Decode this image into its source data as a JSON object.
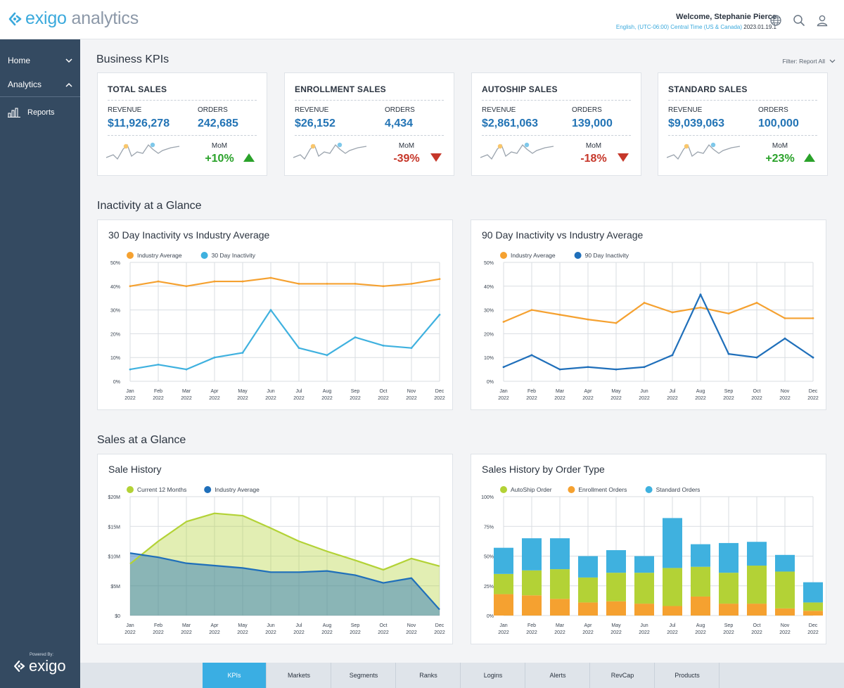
{
  "header": {
    "logo_word": "exigo",
    "logo_word_2": "analytics",
    "welcome": "Welcome, Stephanie Pierce",
    "timezone": "English, (UTC-06:00) Central Time (US & Canada)",
    "date": "2023.01.19.1"
  },
  "sidebar": {
    "items": [
      {
        "label": "Home",
        "icon": "chevron-down-icon"
      },
      {
        "label": "Analytics",
        "icon": "chevron-up-icon"
      }
    ],
    "reports_label": "Reports",
    "powered_by": "Powered By:",
    "powered_logo": "exigo"
  },
  "kpi_section": {
    "title": "Business KPIs",
    "filter": "Filter: Report All",
    "cards": [
      {
        "title": "TOTAL SALES",
        "revenue_label": "REVENUE",
        "revenue": "$11,926,278",
        "orders_label": "ORDERS",
        "orders": "242,685",
        "mom_label": "MoM",
        "mom": "+10%",
        "direction": "up"
      },
      {
        "title": "ENROLLMENT SALES",
        "revenue_label": "REVENUE",
        "revenue": "$26,152",
        "orders_label": "ORDERS",
        "orders": "4,434",
        "mom_label": "MoM",
        "mom": "-39%",
        "direction": "down"
      },
      {
        "title": "AUTOSHIP SALES",
        "revenue_label": "REVENUE",
        "revenue": "$2,861,063",
        "orders_label": "ORDERS",
        "orders": "139,000",
        "mom_label": "MoM",
        "mom": "-18%",
        "direction": "down"
      },
      {
        "title": "STANDARD SALES",
        "revenue_label": "REVENUE",
        "revenue": "$9,039,063",
        "orders_label": "ORDERS",
        "orders": "100,000",
        "mom_label": "MoM",
        "mom": "+23%",
        "direction": "up"
      }
    ]
  },
  "inactivity_section": {
    "title": "Inactivity at a Glance"
  },
  "sales_section": {
    "title": "Sales at a Glance"
  },
  "colors": {
    "orange": "#f5a130",
    "light_blue": "#3fb1df",
    "dark_blue": "#1f6fba",
    "lime": "#b3d236",
    "up": "#2aa22a",
    "down": "#c6372a",
    "tab_active": "#3aaee3"
  },
  "tabs": [
    {
      "label": "KPIs",
      "active": true
    },
    {
      "label": "Markets",
      "active": false
    },
    {
      "label": "Segments",
      "active": false
    },
    {
      "label": "Ranks",
      "active": false
    },
    {
      "label": "Logins",
      "active": false
    },
    {
      "label": "Alerts",
      "active": false
    },
    {
      "label": "RevCap",
      "active": false
    },
    {
      "label": "Products",
      "active": false
    }
  ],
  "chart_data": [
    {
      "type": "line",
      "title": "30 Day Inactivity vs Industry Average",
      "x": [
        "Jan 2022",
        "Feb 2022",
        "Mar 2022",
        "Apr 2022",
        "May 2022",
        "Jun 2022",
        "Jul 2022",
        "Aug 2022",
        "Sep 2022",
        "Oct 2022",
        "Nov 2022",
        "Dec 2022"
      ],
      "yticks": [
        "0%",
        "10%",
        "20%",
        "30%",
        "40%",
        "50%"
      ],
      "ylim": [
        0,
        50
      ],
      "legend": "top-left",
      "grid": true,
      "series": [
        {
          "name": "Industry Average",
          "color": "#f5a130",
          "values": [
            40,
            42,
            40,
            42,
            42,
            43.5,
            41,
            41,
            41,
            40,
            41,
            43
          ]
        },
        {
          "name": "30 Day Inactivity",
          "color": "#3fb1df",
          "values": [
            5,
            7,
            5,
            10,
            12,
            30,
            14,
            11,
            18.5,
            15,
            14,
            28
          ]
        }
      ]
    },
    {
      "type": "line",
      "title": "90 Day Inactivity vs Industry Average",
      "x": [
        "Jan 2022",
        "Feb 2022",
        "Mar 2022",
        "Apr 2022",
        "May 2022",
        "Jun 2022",
        "Jul 2022",
        "Aug 2022",
        "Sep 2022",
        "Oct 2022",
        "Nov 2022",
        "Dec 2022"
      ],
      "yticks": [
        "0%",
        "10%",
        "20%",
        "30%",
        "40%",
        "50%"
      ],
      "ylim": [
        0,
        50
      ],
      "legend": "top-left",
      "grid": true,
      "series": [
        {
          "name": "Industry Average",
          "color": "#f5a130",
          "values": [
            25,
            30,
            28,
            26,
            24.5,
            33,
            29,
            31,
            28.5,
            33,
            26.5,
            26.5
          ]
        },
        {
          "name": "90 Day Inactivity",
          "color": "#1f6fba",
          "values": [
            6,
            11,
            5,
            6,
            5,
            6,
            11,
            36.5,
            11.5,
            10,
            18,
            10
          ]
        }
      ]
    },
    {
      "type": "area",
      "title": "Sale History",
      "x": [
        "Jan 2022",
        "Feb 2022",
        "Mar 2022",
        "Apr 2022",
        "May 2022",
        "Jun 2022",
        "Jul 2022",
        "Aug 2022",
        "Sep 2022",
        "Oct 2022",
        "Nov 2022",
        "Dec 2022"
      ],
      "yticks": [
        "$0",
        "$5M",
        "$10M",
        "$15M",
        "$20M"
      ],
      "ylim": [
        0,
        20
      ],
      "unit": "$M",
      "legend": "top-left",
      "grid": true,
      "series": [
        {
          "name": "Current 12 Months",
          "color": "#b3d236",
          "values": [
            8.7,
            12.5,
            15.8,
            17.2,
            16.8,
            14.7,
            12.5,
            10.8,
            9.3,
            7.7,
            9.6,
            8.3
          ]
        },
        {
          "name": "Industry Average",
          "color": "#1f6fba",
          "values": [
            10.5,
            9.8,
            8.8,
            8.4,
            8.0,
            7.3,
            7.3,
            7.5,
            6.8,
            5.5,
            6.3,
            1.0
          ]
        }
      ]
    },
    {
      "type": "bar",
      "stacked": true,
      "title": "Sales History by Order Type",
      "categories": [
        "Jan 2022",
        "Feb 2022",
        "Mar 2022",
        "Apr 2022",
        "May 2022",
        "Jun 2022",
        "Jul 2022",
        "Aug 2022",
        "Sep 2022",
        "Oct 2022",
        "Nov 2022",
        "Dec 2022"
      ],
      "yticks": [
        "0%",
        "25%",
        "50%",
        "75%",
        "100%"
      ],
      "ylim": [
        0,
        100
      ],
      "legend": "top-left",
      "grid": true,
      "series": [
        {
          "name": "AutoShip Order",
          "color": "#b3d236",
          "values": [
            17,
            21,
            25,
            21,
            24,
            26,
            32,
            25,
            26,
            32,
            31,
            7
          ]
        },
        {
          "name": "Enrollment Orders",
          "color": "#f5a130",
          "values": [
            18,
            17,
            14,
            11,
            12,
            10,
            8,
            16,
            10,
            10,
            6,
            4
          ]
        },
        {
          "name": "Standard Orders",
          "color": "#3fb1df",
          "values": [
            22,
            27,
            26,
            18,
            19,
            14,
            42,
            19,
            25,
            20,
            14,
            17
          ]
        }
      ]
    }
  ]
}
